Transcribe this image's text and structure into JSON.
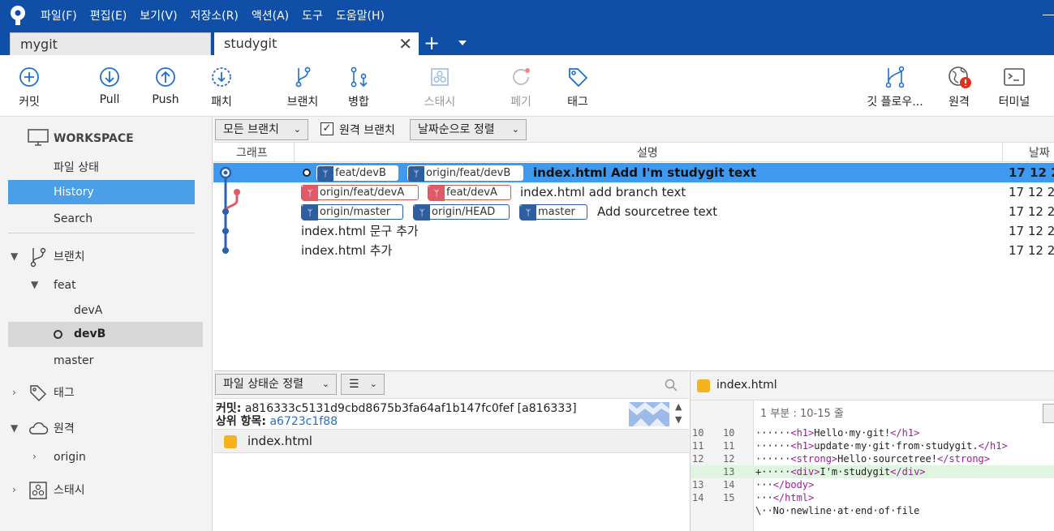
{
  "menu": [
    "파일(F)",
    "편집(E)",
    "보기(V)",
    "저장소(R)",
    "액션(A)",
    "도구",
    "도움말(H)"
  ],
  "tabs": [
    {
      "label": "mygit"
    },
    {
      "label": "studygit"
    }
  ],
  "tab_close": "✕",
  "tab_add": "+",
  "toolbar": {
    "commit": "커밋",
    "pull": "Pull",
    "push": "Push",
    "patch": "패치",
    "branch": "브랜치",
    "merge": "병합",
    "stash": "스태시",
    "discard": "폐기",
    "tag": "태그",
    "gitflow": "깃 플로우...",
    "remote": "원격",
    "terminal": "터미널"
  },
  "sidebar": {
    "workspace": "WORKSPACE",
    "file_status": "파일 상태",
    "history": "History",
    "search": "Search",
    "branches": "브랜치",
    "feat": "feat",
    "devA": "devA",
    "devB": "devB",
    "master": "master",
    "tags": "태그",
    "remotes": "원격",
    "origin": "origin",
    "stashes": "스태시"
  },
  "filter": {
    "all_branches": "모든 브랜치",
    "remote_branches": "원격 브랜치",
    "remote_checked": true,
    "sort": "날짜순으로 정렬"
  },
  "columns": {
    "graph": "그래프",
    "description": "설명",
    "date": "날짜"
  },
  "commits": [
    {
      "badges": [
        "feat/devB",
        "origin/feat/devB"
      ],
      "message": "index.html Add I'm studygit text",
      "date": "17 12 2"
    },
    {
      "badges": [
        "origin/feat/devA",
        "feat/devA"
      ],
      "message": "index.html add branch text",
      "date": "17 12 2"
    },
    {
      "badges": [
        "origin/master",
        "origin/HEAD",
        "master"
      ],
      "message": "Add sourcetree text",
      "date": "17 12 2"
    },
    {
      "badges": [],
      "message": "index.html 문구 추가",
      "date": "17 12 2"
    },
    {
      "badges": [],
      "message": "index.html 추가",
      "date": "17 12 2"
    }
  ],
  "detail": {
    "sort": "파일 상태순 정렬",
    "list_icon": "☰",
    "commit_label": "커밋:",
    "commit_hash": "a816333c5131d9cbd8675b3fa64af1b147fc0fef [a816333]",
    "parent_label": "상위 항목:",
    "parent_hash": "a6723c1f88",
    "file": "index.html"
  },
  "diff": {
    "file": "index.html",
    "hunk": "1 부분 : 10-15 줄",
    "lines": [
      {
        "old": "10",
        "new": "10",
        "text": "······<h1>Hello·my·git!</h1>",
        "added": false
      },
      {
        "old": "11",
        "new": "11",
        "text": "······<h1>update·my·git·from·studygit.</h1>",
        "added": false
      },
      {
        "old": "12",
        "new": "12",
        "text": "······<strong>Hello·sourcetree!</strong>",
        "added": false
      },
      {
        "old": "",
        "new": "13",
        "text": "+·····<div>I'm·studygit</div>",
        "added": true
      },
      {
        "old": "13",
        "new": "14",
        "text": "···</body>",
        "added": false
      },
      {
        "old": "14",
        "new": "15",
        "text": "···</html>",
        "added": false
      },
      {
        "old": "",
        "new": "",
        "text": "\\··No·newline·at·end·of·file",
        "added": false
      }
    ]
  }
}
